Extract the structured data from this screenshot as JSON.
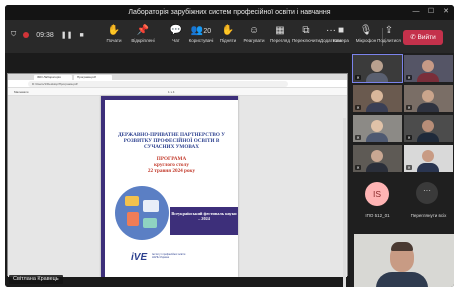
{
  "window": {
    "title": "Лабораторія зарубіжних систем професійної освіти і навчання",
    "controls": [
      "—",
      "☐",
      "✕"
    ]
  },
  "toolbar": {
    "timer": "09:38",
    "items": [
      {
        "label": "Почати",
        "icon": "hand-icon",
        "glyph": "✋"
      },
      {
        "label": "Відкріплені",
        "icon": "pin-icon",
        "glyph": "📌"
      },
      {
        "label": "Чат",
        "icon": "chat-icon",
        "glyph": "💬"
      },
      {
        "label": "Користувачі",
        "icon": "people-icon",
        "glyph": "👥",
        "count": "20"
      },
      {
        "label": "Підняти",
        "icon": "raise-hand-icon",
        "glyph": "✋"
      },
      {
        "label": "Реагувати",
        "icon": "smile-icon",
        "glyph": "☺"
      },
      {
        "label": "Перегляд",
        "icon": "view-grid-icon",
        "glyph": "▦"
      },
      {
        "label": "Переключити",
        "icon": "rooms-icon",
        "glyph": "⧉"
      },
      {
        "label": "Додатково",
        "icon": "more-icon",
        "glyph": "···"
      },
      {
        "label": "Камера",
        "icon": "camera-icon",
        "glyph": "■"
      },
      {
        "label": "Мікрофон",
        "icon": "mic-off-icon",
        "glyph": "🎙"
      },
      {
        "label": "Поділитися",
        "icon": "share-icon",
        "glyph": "⇪"
      }
    ],
    "leave_label": "Вийти"
  },
  "browser": {
    "tabs": [
      "ІМО Лабораторія",
      "Програма.pdf"
    ],
    "url": "D:/Users/1/Desktop/Програма.pdf",
    "pdf_label": "Малювати",
    "page_indicator": "1 з 4"
  },
  "document": {
    "title": "ДЕРЖАВНО-ПРИВАТНЕ ПАРТНЕРСТВО У РОЗВИТКУ ПРОФЕСІЙНОЇ ОСВІТИ В СУЧАСНИХ УМОВАХ",
    "program_label": "ПРОГРАМА",
    "event": "круглого столу",
    "date": "22 травня 2024 року",
    "festival": "Всеукраїнський фестиваль науки – 2024",
    "logo": "iVE",
    "logo_sub": "Інститут професійної освіти НАПН України"
  },
  "presenter": {
    "name": "Світлана Кравець"
  },
  "participants": {
    "avatar_initials": "ІS",
    "avatar_name": "ІПО 512_01",
    "more_label": "Переглянути всіх"
  },
  "colors": {
    "accent": "#7b83eb",
    "leave": "#c4314b",
    "doc_purple": "#3d2f7a",
    "doc_blue": "#2b3f8e",
    "doc_red": "#c23a2b"
  }
}
